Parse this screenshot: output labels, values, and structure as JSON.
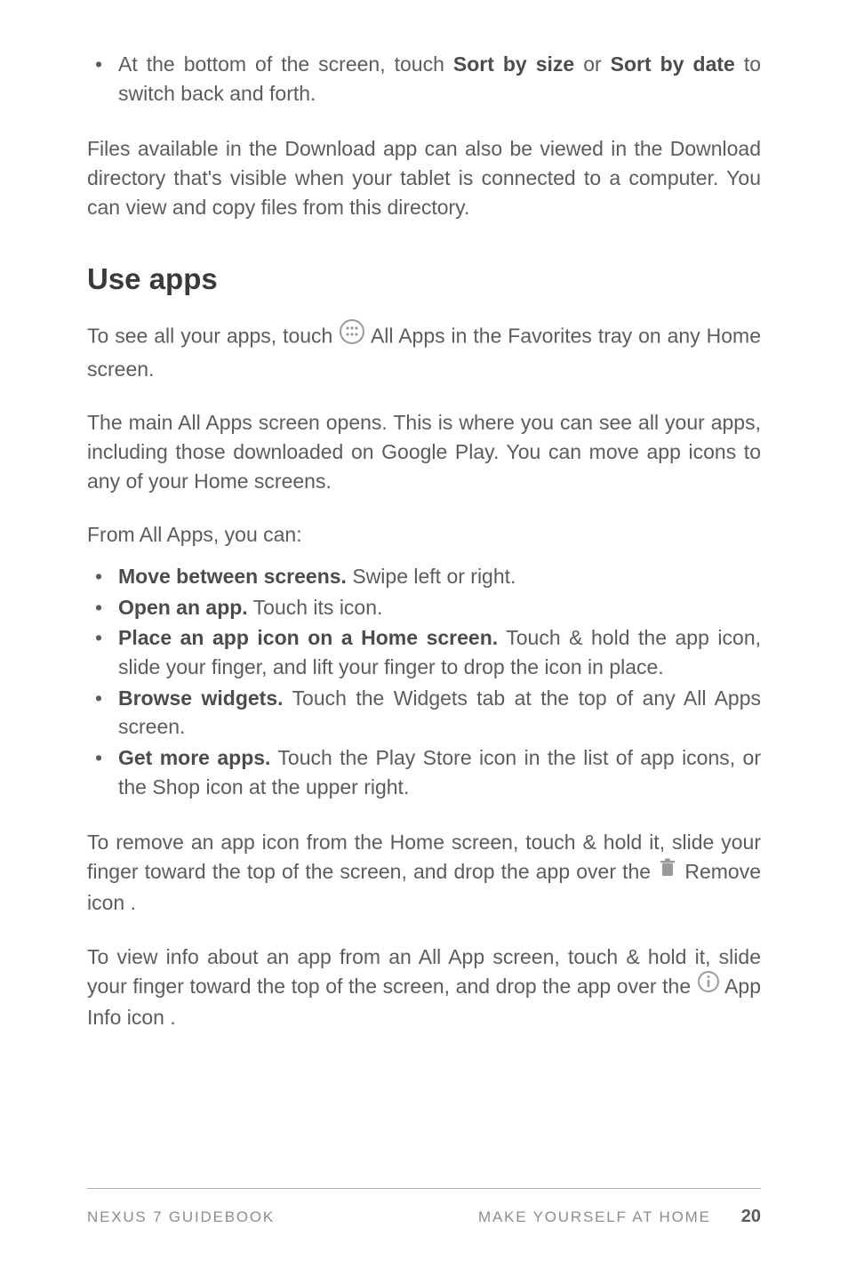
{
  "topBullet": {
    "pre": "At the bottom of the screen, touch ",
    "bold1": "Sort by size",
    "mid": " or ",
    "bold2": "Sort by date",
    "post": " to switch back and forth."
  },
  "para1": "Files available in the Download app can also be viewed in the Download directory that's visible when your tablet is connected to a computer. You can view and copy files from this directory.",
  "heading": "Use apps",
  "para2": {
    "pre": "To see all your apps, touch ",
    "post": " All Apps in the Favorites tray on any Home screen."
  },
  "para3": "The main All Apps screen opens. This is where you can see all your apps, including those downloaded on Google Play. You can move app icons to any of your Home screens.",
  "para4": "From All Apps, you can:",
  "actions": [
    {
      "bold": "Move between screens.",
      "rest": " Swipe left or right."
    },
    {
      "bold": "Open an app.",
      "rest": " Touch its icon."
    },
    {
      "bold": "Place an app icon on a Home screen.",
      "rest": " Touch & hold the app icon, slide your finger, and lift your finger to drop the icon in place."
    },
    {
      "bold": "Browse widgets.",
      "rest": " Touch the Widgets tab at the top of any All Apps screen."
    },
    {
      "bold": "Get more apps.",
      "rest": " Touch the Play Store icon in the list of app icons, or the Shop icon at the upper right."
    }
  ],
  "para5": {
    "pre": "To remove an app icon from the Home screen, touch & hold it, slide your finger toward the top of the screen, and drop the app over the ",
    "post": " Remove icon ."
  },
  "para6": {
    "pre": "To view info about an app from an All App screen, touch & hold it, slide your finger toward the top of the screen, and drop the app over the ",
    "post": " App Info icon ."
  },
  "footer": {
    "left": "NEXUS 7 GUIDEBOOK",
    "section": "MAKE YOURSELF AT HOME",
    "page": "20"
  }
}
